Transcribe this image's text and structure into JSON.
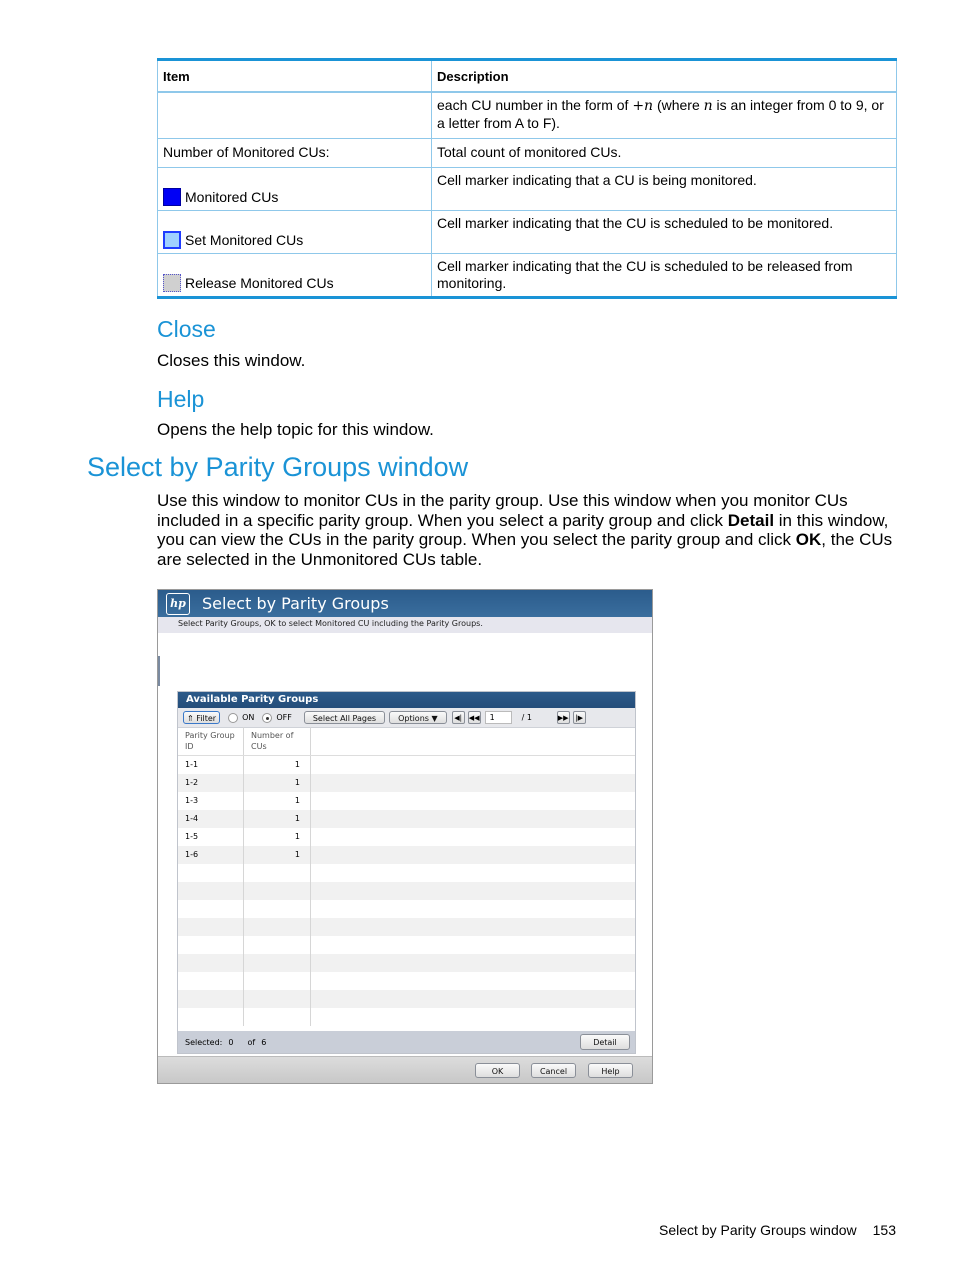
{
  "table": {
    "headers": [
      "Item",
      "Description"
    ],
    "rows": [
      {
        "item": "",
        "description_parts": [
          "each CU number in the form of ",
          "+n",
          " (where ",
          "n",
          " is an integer from 0 to 9, or a letter from A to F)."
        ]
      },
      {
        "item": "Number of Monitored CUs:",
        "description": "Total count of monitored CUs."
      },
      {
        "item": "Monitored CUs",
        "marker": "monitored",
        "description": "Cell marker indicating that a CU is being monitored."
      },
      {
        "item": "Set Monitored CUs",
        "marker": "set-monitored",
        "description": "Cell marker indicating that the CU is scheduled to be monitored."
      },
      {
        "item": "Release Monitored CUs",
        "marker": "release-monitored",
        "description": "Cell marker indicating that the CU is scheduled to be released from monitoring."
      }
    ]
  },
  "close_section": {
    "heading": "Close",
    "text": "Closes this window."
  },
  "help_section": {
    "heading": "Help",
    "text": "Opens the help topic for this window."
  },
  "section": {
    "title": "Select by Parity Groups window",
    "para": {
      "p1": "Use this window to monitor CUs in the parity group. Use this window when you monitor CUs included in a specific parity group. When you select a parity group and click ",
      "b1": "Detail",
      "p2": " in this window, you can view the CUs in the parity group. When you select the parity group and click ",
      "b2": "OK",
      "p3": ", the CUs are selected in the Unmonitored CUs table."
    }
  },
  "window": {
    "logo": "hp",
    "title": "Select by Parity Groups",
    "instruction": "Select Parity Groups, OK to select Monitored CU including the Parity Groups.",
    "panel": {
      "title": "Available Parity Groups",
      "toolbar": {
        "filter_label": "Filter",
        "on_label": "ON",
        "off_label": "OFF",
        "filter_state": "OFF",
        "select_all_label": "Select All Pages",
        "options_label": "Options",
        "page_value": "1",
        "page_total": "/ 1"
      },
      "columns": [
        "Parity Group ID",
        "Number of CUs"
      ],
      "rows": [
        {
          "id": "1-1",
          "cus": "1"
        },
        {
          "id": "1-2",
          "cus": "1"
        },
        {
          "id": "1-3",
          "cus": "1"
        },
        {
          "id": "1-4",
          "cus": "1"
        },
        {
          "id": "1-5",
          "cus": "1"
        },
        {
          "id": "1-6",
          "cus": "1"
        }
      ],
      "selected_label": "Selected:",
      "selected_count": "0",
      "of_label": "of",
      "total_count": "6",
      "detail_label": "Detail"
    },
    "buttons": {
      "ok": "OK",
      "cancel": "Cancel",
      "help": "Help"
    }
  },
  "page_footer": {
    "title": "Select by Parity Groups window",
    "page_number": "153"
  }
}
